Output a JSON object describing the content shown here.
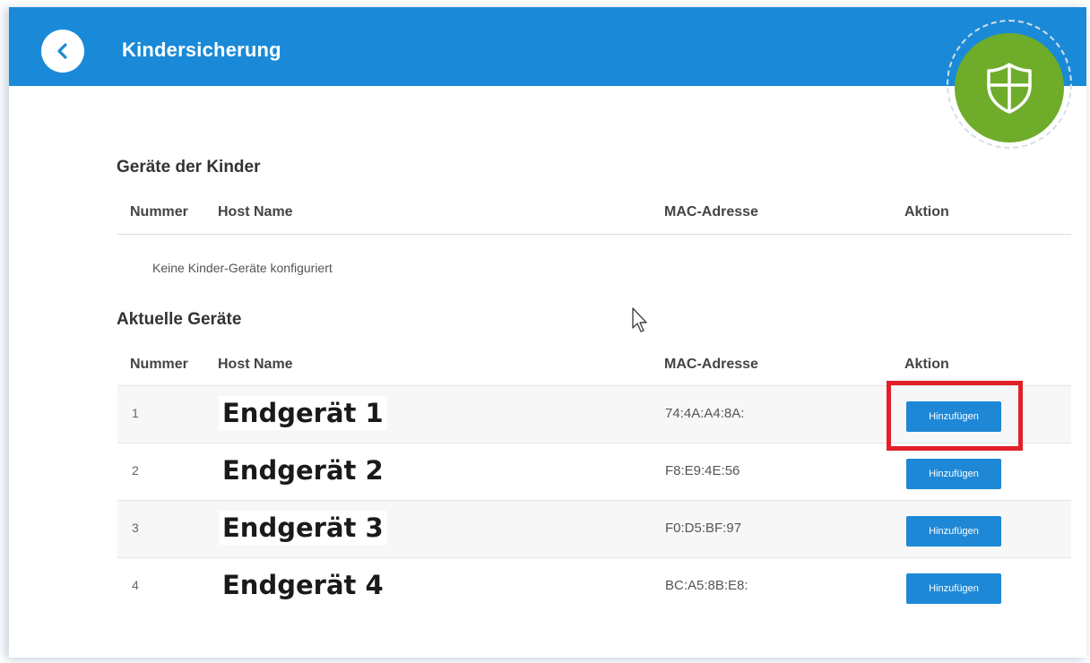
{
  "header": {
    "title": "Kindersicherung",
    "bg_color": "#1a8ad8",
    "badge_color": "#6fac2a"
  },
  "children_devices": {
    "section_title": "Geräte der Kinder",
    "columns": [
      "Nummer",
      "Host Name",
      "MAC-Adresse",
      "Aktion"
    ],
    "empty_message": "Keine Kinder-Geräte konfiguriert"
  },
  "current_devices": {
    "section_title": "Aktuelle Geräte",
    "columns": [
      "Nummer",
      "Host Name",
      "MAC-Adresse",
      "Aktion"
    ],
    "rows": [
      {
        "number": "1",
        "host": "Endgerät 1",
        "mac": "74:4A:A4:8A:",
        "action": "Hinzufügen"
      },
      {
        "number": "2",
        "host": "Endgerät 2",
        "mac": "F8:E9:4E:56",
        "action": "Hinzufügen"
      },
      {
        "number": "3",
        "host": "Endgerät 3",
        "mac": "F0:D5:BF:97",
        "action": "Hinzufügen"
      },
      {
        "number": "4",
        "host": "Endgerät 4",
        "mac": "BC:A5:8B:E8:",
        "action": "Hinzufügen"
      }
    ]
  },
  "icons": {
    "back": "chevron-left-icon",
    "badge": "shield-icon",
    "cursor": "mouse-pointer-icon"
  },
  "highlight_color": "#e1202a"
}
